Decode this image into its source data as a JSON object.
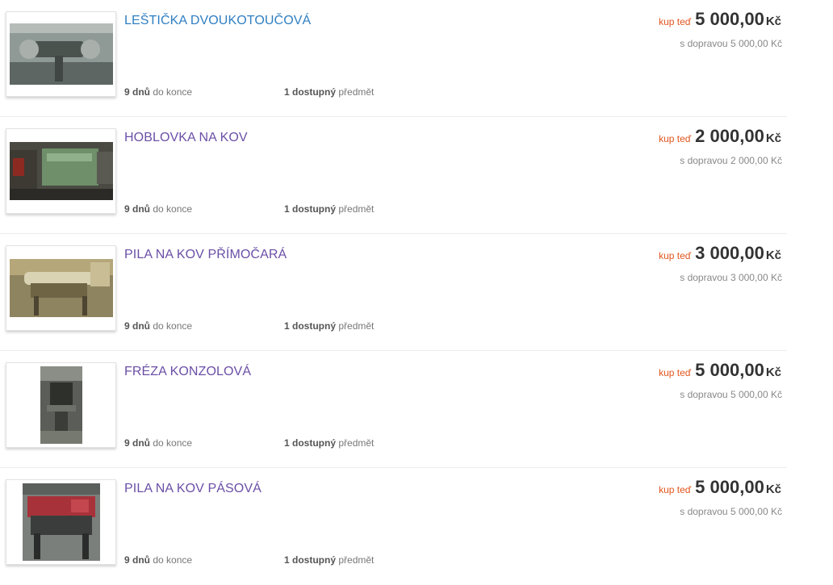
{
  "listings": [
    {
      "title": "LEŠTIČKA DVOUKOTOUČOVÁ",
      "visited": false,
      "days_num": "9 dnů",
      "days_rest": "do konce",
      "stock_num": "1 dostupný",
      "stock_rest": "předmět",
      "buy_label": "kup teď",
      "price": "5 000,00",
      "currency": "Kč",
      "shipping": "s dopravou 5 000,00 Kč",
      "photo_colors": [
        "#7d8a86",
        "#4b534f",
        "#a9b0ac"
      ]
    },
    {
      "title": "HOBLOVKA NA KOV",
      "visited": true,
      "days_num": "9 dnů",
      "days_rest": "do konce",
      "stock_num": "1 dostupný",
      "stock_rest": "předmět",
      "buy_label": "kup teď",
      "price": "2 000,00",
      "currency": "Kč",
      "shipping": "s dopravou 2 000,00 Kč",
      "photo_colors": [
        "#6f8f6a",
        "#3d3a33",
        "#8c2a22"
      ]
    },
    {
      "title": "PILA NA KOV PŘÍMOČARÁ",
      "visited": true,
      "days_num": "9 dnů",
      "days_rest": "do konce",
      "stock_num": "1 dostupný",
      "stock_rest": "předmět",
      "buy_label": "kup teď",
      "price": "3 000,00",
      "currency": "Kč",
      "shipping": "s dopravou 3 000,00 Kč",
      "photo_colors": [
        "#b5a77a",
        "#d9d2b3",
        "#6f6444"
      ]
    },
    {
      "title": "FRÉZA KONZOLOVÁ",
      "visited": true,
      "days_num": "9 dnů",
      "days_rest": "do konce",
      "stock_num": "1 dostupný",
      "stock_rest": "předmět",
      "buy_label": "kup teď",
      "price": "5 000,00",
      "currency": "Kč",
      "shipping": "s dopravou 5 000,00 Kč",
      "photo_colors": [
        "#5b5d58",
        "#8a8e86",
        "#2e302c"
      ]
    },
    {
      "title": "PILA NA KOV PÁSOVÁ",
      "visited": true,
      "days_num": "9 dnů",
      "days_rest": "do konce",
      "stock_num": "1 dostupný",
      "stock_rest": "předmět",
      "buy_label": "kup teď",
      "price": "5 000,00",
      "currency": "Kč",
      "shipping": "s dopravou 5 000,00 Kč",
      "photo_colors": [
        "#a8323a",
        "#3a3d3b",
        "#7b7f7c"
      ]
    }
  ]
}
